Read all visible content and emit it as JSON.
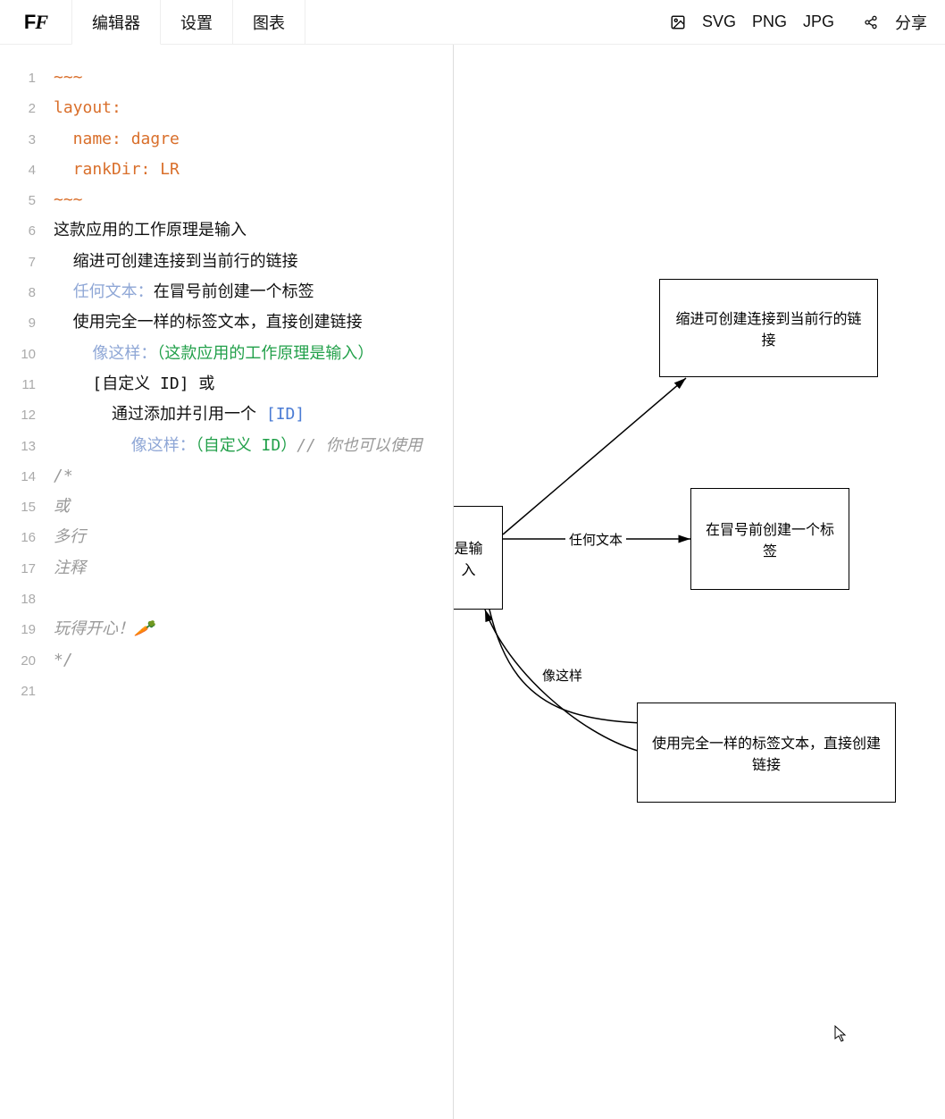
{
  "header": {
    "logo": "FF",
    "tabs": {
      "editor": "编辑器",
      "settings": "设置",
      "chart": "图表"
    },
    "actions": {
      "svg": "SVG",
      "png": "PNG",
      "jpg": "JPG",
      "share": "分享"
    }
  },
  "editor": {
    "lines": [
      {
        "n": 1,
        "segments": [
          {
            "cls": "orange",
            "t": "~~~"
          }
        ]
      },
      {
        "n": 2,
        "segments": [
          {
            "cls": "orange",
            "t": "layout:"
          }
        ]
      },
      {
        "n": 3,
        "segments": [
          {
            "cls": "orange",
            "t": "  name: dagre"
          }
        ]
      },
      {
        "n": 4,
        "segments": [
          {
            "cls": "orange",
            "t": "  rankDir: LR"
          }
        ]
      },
      {
        "n": 5,
        "segments": [
          {
            "cls": "orange",
            "t": "~~~"
          }
        ]
      },
      {
        "n": 6,
        "segments": [
          {
            "cls": "default-text",
            "t": "这款应用的工作原理是输入"
          }
        ]
      },
      {
        "n": 7,
        "segments": [
          {
            "cls": "default-text",
            "t": "  缩进可创建连接到当前行的链接"
          }
        ]
      },
      {
        "n": 8,
        "segments": [
          {
            "cls": "default-text",
            "t": "  "
          },
          {
            "cls": "label-blue",
            "t": "任何文本："
          },
          {
            "cls": "default-text",
            "t": "在冒号前创建一个标签"
          }
        ]
      },
      {
        "n": 9,
        "segments": [
          {
            "cls": "default-text",
            "t": "  使用完全一样的标签文本，直接创建链接"
          }
        ]
      },
      {
        "n": 10,
        "segments": [
          {
            "cls": "default-text",
            "t": "    "
          },
          {
            "cls": "label-blue",
            "t": "像这样："
          },
          {
            "cls": "green",
            "t": "（这款应用的工作原理是输入）"
          }
        ]
      },
      {
        "n": 11,
        "segments": [
          {
            "cls": "default-text",
            "t": "    "
          },
          {
            "cls": "brackets",
            "t": "[自定义 ID]"
          },
          {
            "cls": "default-text",
            "t": " 或"
          }
        ]
      },
      {
        "n": 12,
        "segments": [
          {
            "cls": "default-text",
            "t": "      通过添加并引用一个 "
          },
          {
            "cls": "id-blue",
            "t": "[ID]"
          }
        ]
      },
      {
        "n": 13,
        "segments": [
          {
            "cls": "default-text",
            "t": "        "
          },
          {
            "cls": "label-blue",
            "t": "像这样："
          },
          {
            "cls": "green",
            "t": "（自定义 ID）"
          },
          {
            "cls": "comment-gray",
            "t": "// 你也可以使用"
          }
        ]
      },
      {
        "n": 14,
        "segments": [
          {
            "cls": "comment-gray",
            "t": "/*"
          }
        ]
      },
      {
        "n": 15,
        "segments": [
          {
            "cls": "comment-gray",
            "t": "或"
          }
        ]
      },
      {
        "n": 16,
        "segments": [
          {
            "cls": "comment-gray",
            "t": "多行"
          }
        ]
      },
      {
        "n": 17,
        "segments": [
          {
            "cls": "comment-gray",
            "t": "注释"
          }
        ]
      },
      {
        "n": 18,
        "segments": []
      },
      {
        "n": 19,
        "segments": [
          {
            "cls": "comment-gray",
            "t": "玩得开心！🥕"
          }
        ]
      },
      {
        "n": 20,
        "segments": [
          {
            "cls": "comment-gray",
            "t": "*/"
          }
        ]
      },
      {
        "n": 21,
        "segments": []
      }
    ]
  },
  "diagram": {
    "nodes": {
      "root": "是输入",
      "n1": "缩进可创建连接到当前行的链接",
      "n2": "在冒号前创建一个标签",
      "n3": "使用完全一样的标签文本，直接创建链接"
    },
    "edge_labels": {
      "e2": "任何文本",
      "e3": "像这样"
    }
  }
}
